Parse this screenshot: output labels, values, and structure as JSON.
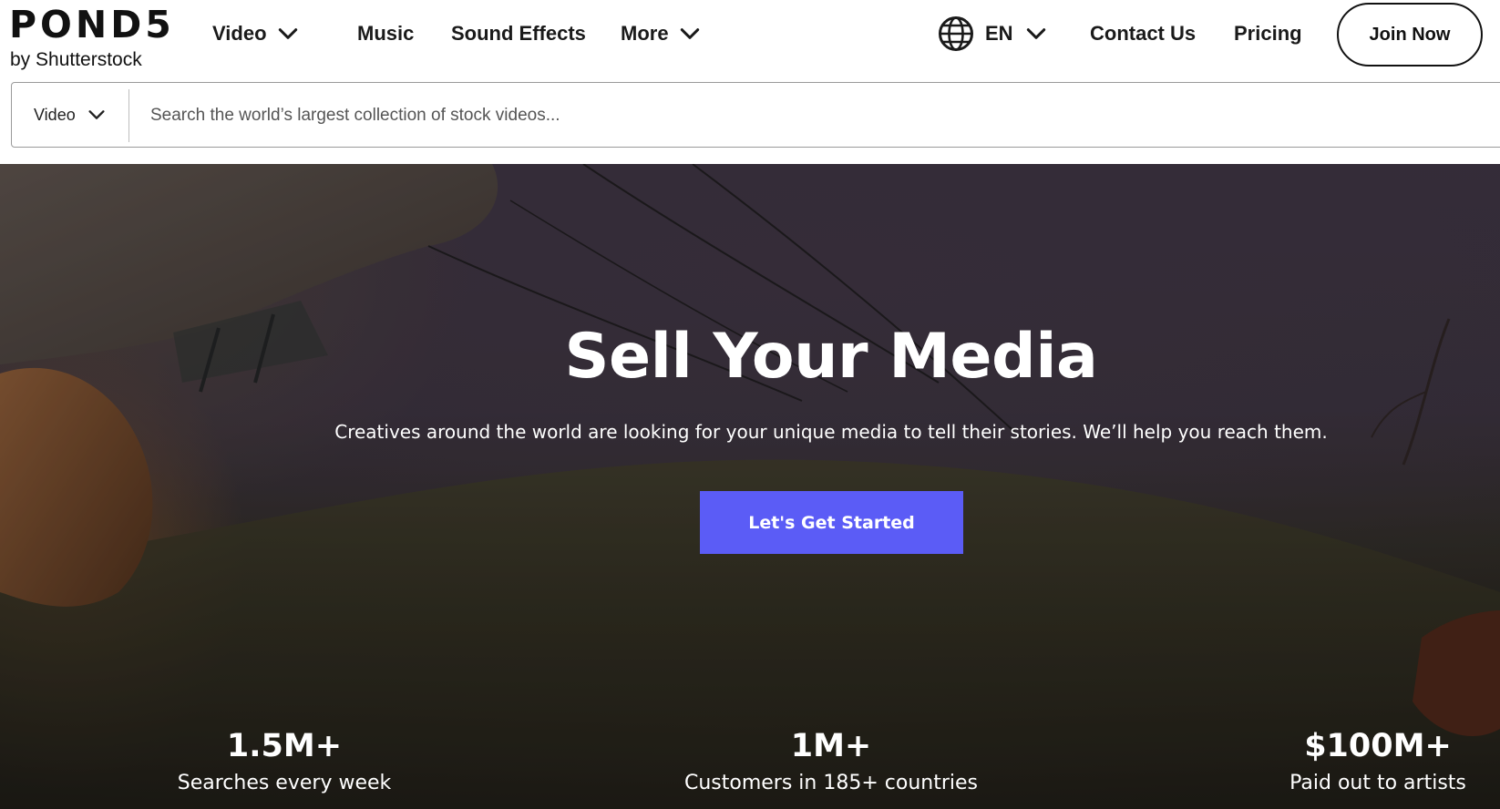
{
  "brand": {
    "logo_text": "POND5",
    "logo_sub": "by Shutterstock"
  },
  "nav": {
    "video_label": "Video",
    "music_label": "Music",
    "sfx_label": "Sound Effects",
    "more_label": "More",
    "lang_label": "EN",
    "contact_label": "Contact Us",
    "pricing_label": "Pricing",
    "join_label": "Join Now"
  },
  "search": {
    "type_label": "Video",
    "placeholder": "Search the world’s largest collection of stock videos...",
    "value": ""
  },
  "hero": {
    "title": "Sell Your Media",
    "subtitle": "Creatives around the world are looking for your unique media to tell their stories. We’ll help you reach them.",
    "cta_label": "Let's Get Started",
    "cta_color": "#5b5cf6"
  },
  "stats": [
    {
      "value": "1.5M+",
      "label": "Searches every week"
    },
    {
      "value": "1M+",
      "label": "Customers in 185+ countries"
    },
    {
      "value": "$100M+",
      "label": "Paid out to artists"
    }
  ],
  "icons": {
    "chevron": "chevron-down-icon",
    "globe": "globe-icon"
  }
}
